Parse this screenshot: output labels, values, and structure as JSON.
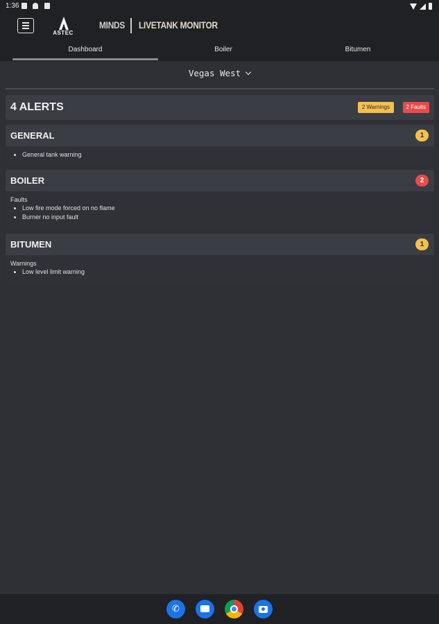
{
  "status_bar": {
    "time": "1:36"
  },
  "header": {
    "logo_text": "ASTEC",
    "brand": "MINDS",
    "app_title": "LIVETANK MONITOR",
    "icons": [
      "menu-icon"
    ]
  },
  "tabs": [
    {
      "label": "Dashboard",
      "active": true
    },
    {
      "label": "Boiler",
      "active": false
    },
    {
      "label": "Bitumen",
      "active": false
    }
  ],
  "site_select": {
    "value": "Vegas West"
  },
  "summary": {
    "title": "4 ALERTS",
    "warnings_badge": "2 Warnings",
    "faults_badge": "2 Faults"
  },
  "sections": {
    "general": {
      "title": "GENERAL",
      "count": "1",
      "items": [
        "General tank warning"
      ]
    },
    "boiler": {
      "title": "BOILER",
      "count": "2",
      "group_label": "Faults",
      "items": [
        "Low fire mode forced on no flame",
        "Burner no input fault"
      ]
    },
    "bitumen": {
      "title": "BITUMEN",
      "count": "1",
      "group_label": "Warnings",
      "items": [
        "Low level limit warning"
      ]
    }
  },
  "colors": {
    "background": "#2e3036",
    "card_header": "#3b3d44",
    "warning": "#f5c04e",
    "fault": "#e74c4c"
  },
  "dock": [
    "phone-icon",
    "messages-icon",
    "chrome-icon",
    "camera-icon"
  ]
}
